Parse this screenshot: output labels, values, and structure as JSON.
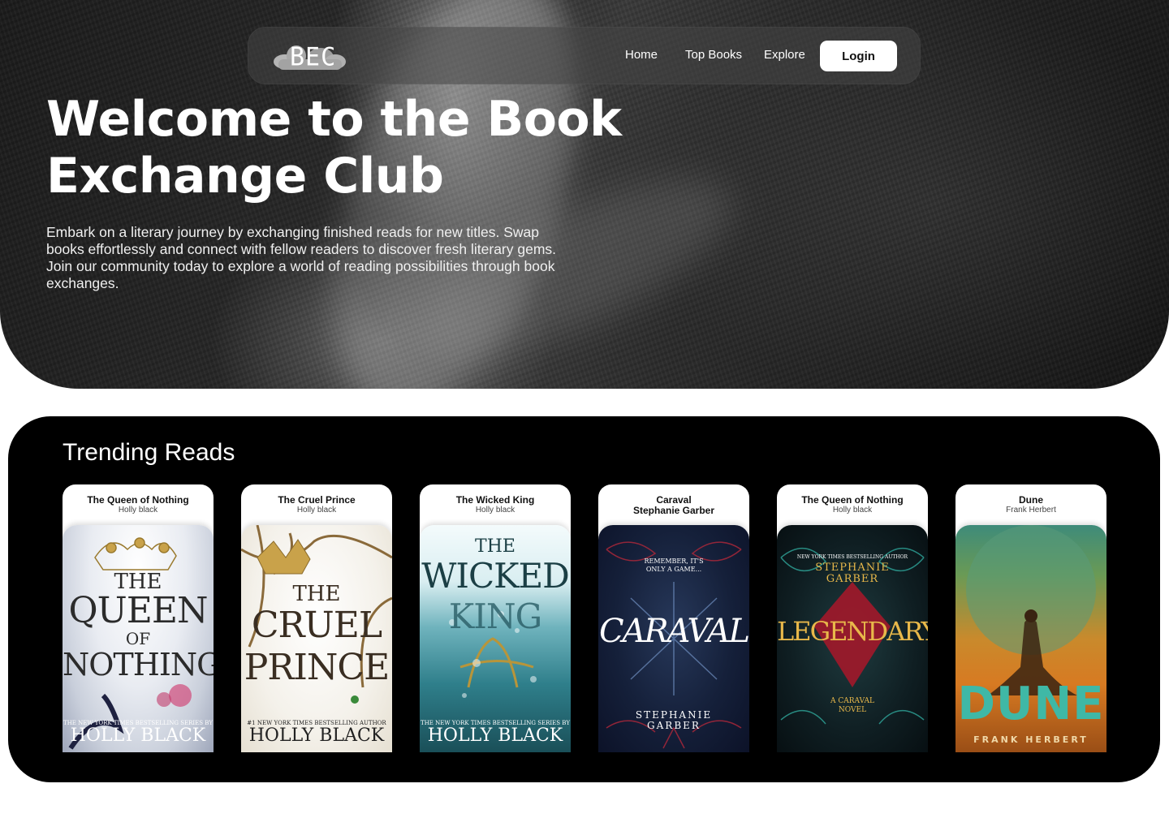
{
  "nav": {
    "logo_text": "BEC",
    "links": [
      "Home",
      "Top Books",
      "Explore"
    ],
    "login_label": "Login"
  },
  "hero": {
    "title": "Welcome to the Book Exchange Club",
    "description": "Embark on a literary journey by exchanging finished reads for new titles. Swap books effortlessly and connect with fellow readers to discover fresh literary gems. Join our community today to explore a world of reading possibilities through book exchanges."
  },
  "trending": {
    "title": "Trending Reads",
    "books": [
      {
        "title": "The Queen of Nothing",
        "author": "Holly black",
        "cover_lines": [
          "THE",
          "QUEEN",
          "OF",
          "NOTHING"
        ],
        "cover_tagline": "THE NEW YORK TIMES BESTSELLING SERIES BY",
        "cover_author": "HOLLY BLACK"
      },
      {
        "title": "The Cruel Prince",
        "author": "Holly black",
        "cover_lines": [
          "THE",
          "CRUEL",
          "PRINCE"
        ],
        "cover_tagline": "#1 NEW YORK TIMES BESTSELLING AUTHOR",
        "cover_author": "HOLLY BLACK"
      },
      {
        "title": "The Wicked King",
        "author": "Holly black",
        "cover_lines": [
          "THE",
          "WICKED",
          "KING"
        ],
        "cover_tagline": "THE NEW YORK TIMES BESTSELLING SERIES BY",
        "cover_author": "HOLLY BLACK"
      },
      {
        "title": "Caraval",
        "author": "Stephanie Garber",
        "cover_tagline": "REMEMBER, IT'S ONLY A GAME...",
        "cover_lines": [
          "CARAVAL"
        ],
        "cover_author": "STEPHANIE GARBER"
      },
      {
        "title": "The Queen of Nothing",
        "author": "Holly black",
        "cover_tagline": "NEW YORK TIMES BESTSELLING AUTHOR",
        "cover_author": "STEPHANIE GARBER",
        "cover_lines": [
          "LEGENDARY"
        ],
        "cover_sub": "A CARAVAL NOVEL"
      },
      {
        "title": "Dune",
        "author": "Frank Herbert",
        "cover_lines": [
          "DUNE"
        ],
        "cover_author": "FRANK HERBERT"
      }
    ]
  }
}
